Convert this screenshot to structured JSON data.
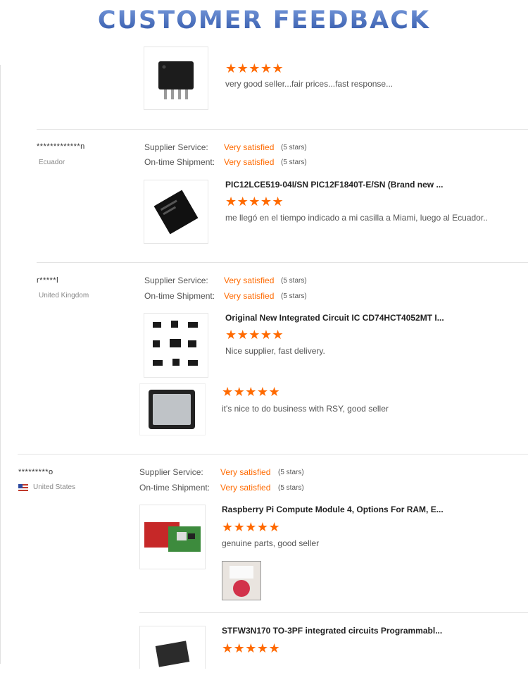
{
  "header": {
    "title": "CUSTOMER FEEDBACK"
  },
  "reviews": [
    {
      "items": [
        {
          "comment": "very good seller...fair prices...fast response...",
          "stars": "★★★★★"
        }
      ]
    },
    {
      "reviewer": "*************n",
      "country": "Ecuador",
      "supplier_label": "Supplier Service:",
      "supplier_value": "Very satisfied",
      "supplier_stars": "(5 stars)",
      "shipment_label": "On-time Shipment:",
      "shipment_value": "Very satisfied",
      "shipment_stars": "(5 stars)",
      "items": [
        {
          "product": "PIC12LCE519-04I/SN PIC12F1840T-E/SN (Brand new ...",
          "stars": "★★★★★",
          "comment": "me llegó en el tiempo indicado a mi casilla a Miami, luego al Ecuador.."
        }
      ]
    },
    {
      "reviewer": "r*****l",
      "country": "United Kingdom",
      "supplier_label": "Supplier Service:",
      "supplier_value": "Very satisfied",
      "supplier_stars": "(5 stars)",
      "shipment_label": "On-time Shipment:",
      "shipment_value": "Very satisfied",
      "shipment_stars": "(5 stars)",
      "items": [
        {
          "product": "Original New Integrated Circuit IC CD74HCT4052MT I...",
          "stars": "★★★★★",
          "comment": "Nice supplier, fast delivery."
        },
        {
          "stars": "★★★★★",
          "comment": "it's nice to do business with RSY, good seller"
        }
      ]
    },
    {
      "reviewer": "*********o",
      "country": "United States",
      "supplier_label": "Supplier Service:",
      "supplier_value": "Very satisfied",
      "supplier_stars": "(5 stars)",
      "shipment_label": "On-time Shipment:",
      "shipment_value": "Very satisfied",
      "shipment_stars": "(5 stars)",
      "items": [
        {
          "product": "Raspberry Pi Compute Module 4, Options For RAM, E...",
          "stars": "★★★★★",
          "comment": "genuine parts, good seller"
        },
        {
          "product": "STFW3N170 TO-3PF integrated circuits Programmabl...",
          "stars": "★★★★★"
        }
      ]
    }
  ],
  "colors": {
    "accent": "#ff6a00",
    "title_blue": "#3a5fb4",
    "divider": "#e3e3e3"
  },
  "icons": [
    "us-flag-icon",
    "star-icon"
  ]
}
